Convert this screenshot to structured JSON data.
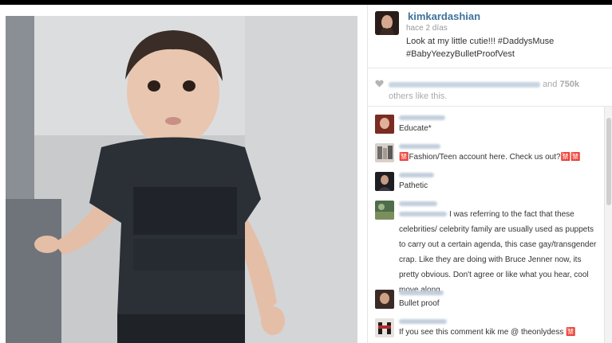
{
  "post": {
    "username": "kimkardashian",
    "timestamp": "hace 2 días",
    "caption_line1": "Look at my little cutie!!! #DaddysMuse",
    "caption_line2": "#BabyYeezyBulletProofVest"
  },
  "likes": {
    "joiner": "and",
    "count": "750k",
    "suffix": "others like this."
  },
  "comments": [
    {
      "text": "Educate*"
    },
    {
      "text": "🈲Fashion/Teen account here. Check us out?🈲🈲"
    },
    {
      "text": "Pathetic"
    },
    {
      "text": "I was referring to the fact that these celebrities/ celebrity family are usually used as puppets to carry out a certain agenda, this case gay/transgender crap. Like they are doing with Bruce Jenner now, its pretty obvious. Don't agree or like what you hear, cool move along."
    },
    {
      "text": "Bullet proof"
    },
    {
      "text": "If you see this comment kik me @ theonlydess 🈲"
    }
  ],
  "colors": {
    "link": "#3f729b",
    "text": "#333333",
    "muted": "#999999",
    "divider": "#e6e6e6"
  },
  "icons": {
    "heart": "heart-icon"
  }
}
